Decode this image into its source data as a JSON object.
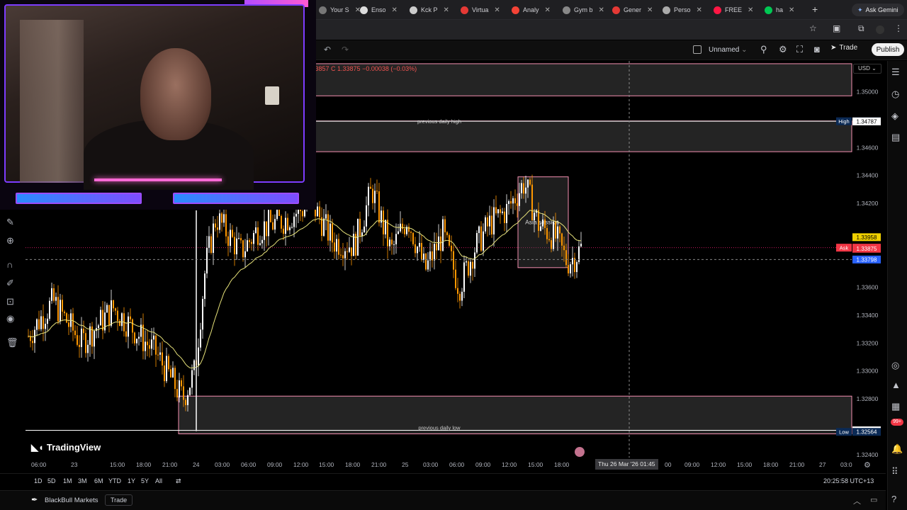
{
  "browser": {
    "tabs": [
      {
        "label": "Your S"
      },
      {
        "label": "Enso"
      },
      {
        "label": "Kck P"
      },
      {
        "label": "Virtua"
      },
      {
        "label": "Analy"
      },
      {
        "label": "Gym b"
      },
      {
        "label": "Gener"
      },
      {
        "label": "Perso"
      },
      {
        "label": "FREE"
      },
      {
        "label": "ha"
      }
    ],
    "new_tab": "+",
    "ask_gemini": "Ask Gemini",
    "tab_close": "✕"
  },
  "toolbar": {
    "undo": "↶",
    "redo": "↷",
    "layout_name": "Unnamed",
    "trade_label": "Trade",
    "publish_label": "Publish"
  },
  "chart_header": {
    "ohlc_text": "1.33857 C 1.33875 −0.00038 (−0.03%)",
    "currency": "USD"
  },
  "chart_data": {
    "type": "line",
    "price_axis_ticks": [
      "1.35000",
      "1.34600",
      "1.34400",
      "1.34200",
      "1.33600",
      "1.33400",
      "1.33200",
      "1.33000",
      "1.32800",
      "1.32400"
    ],
    "price_axis_tick_values": [
      1.35,
      1.346,
      1.344,
      1.342,
      1.336,
      1.334,
      1.332,
      1.33,
      1.328,
      1.324
    ],
    "ylim": [
      1.3238,
      1.3522
    ],
    "price_tags": [
      {
        "label": "High",
        "value": "1.34788",
        "color": "#ffffff",
        "bg": "#0b2a55"
      },
      {
        "label": "",
        "value": "1.34787",
        "color": "#000000",
        "bg": "#ffffff"
      },
      {
        "label": "",
        "value": "1.33958",
        "color": "#000000",
        "bg": "#f0d000"
      },
      {
        "label": "Ask",
        "value": "1.33883",
        "color": "#ffffff",
        "bg": "#f23645"
      },
      {
        "label": "",
        "value": "1.33875",
        "color": "#ffffff",
        "bg": "#f23645"
      },
      {
        "label": "",
        "value": "1.33798",
        "color": "#ffffff",
        "bg": "#2962ff"
      },
      {
        "label": "",
        "value": "1.32575",
        "color": "#000000",
        "bg": "#ffffff"
      },
      {
        "label": "Low",
        "value": "1.32564",
        "color": "#ffffff",
        "bg": "#0b2a55"
      }
    ],
    "zones": [
      {
        "name": "",
        "top": 1.352,
        "bottom": 1.3497
      },
      {
        "name": "previous daily high",
        "top": 1.3479,
        "bottom": 1.3457
      },
      {
        "name": "previous daily low",
        "top": 1.3282,
        "bottom": 1.3255
      }
    ],
    "annotation": {
      "text": "Asia session",
      "start": "14:15",
      "end": "18:00"
    },
    "time_axis": [
      "06:00",
      "23",
      "15:00",
      "18:00",
      "21:00",
      "24",
      "03:00",
      "06:00",
      "09:00",
      "12:00",
      "15:00",
      "18:00",
      "21:00",
      "25",
      "03:00",
      "06:00",
      "09:00",
      "12:00",
      "15:00",
      "18:00",
      "21:00",
      "00",
      "09:00",
      "12:00",
      "15:00",
      "18:00",
      "21:00",
      "27",
      "03:0"
    ],
    "cursor_time": "Thu 26 Mar '26  01:45",
    "colors": {
      "up": "#ffffff",
      "down": "#ff9800",
      "ma": "#e7e27a",
      "zone_border": "#f48fb1",
      "zone_fill": "#2a2a2a",
      "crosshair": "#888888",
      "ask_line": "#c2185b"
    }
  },
  "branding": {
    "logo": "TradingView"
  },
  "ranges": [
    "1D",
    "5D",
    "1M",
    "3M",
    "6M",
    "YTD",
    "1Y",
    "5Y",
    "All"
  ],
  "clock": "20:25:58 UTC+13",
  "broker": {
    "name": "BlackBull Markets",
    "trade_label": "Trade"
  },
  "sidebar": {
    "badge": "99+"
  },
  "icons": {
    "undo": "undo-icon",
    "star": "star-icon",
    "camera": "camera-icon",
    "fullscreen": "fullscreen-icon",
    "settings": "gear-icon",
    "alerts": "alert-clock-icon",
    "watchlist": "watchlist-icon",
    "chat": "chat-icon"
  }
}
